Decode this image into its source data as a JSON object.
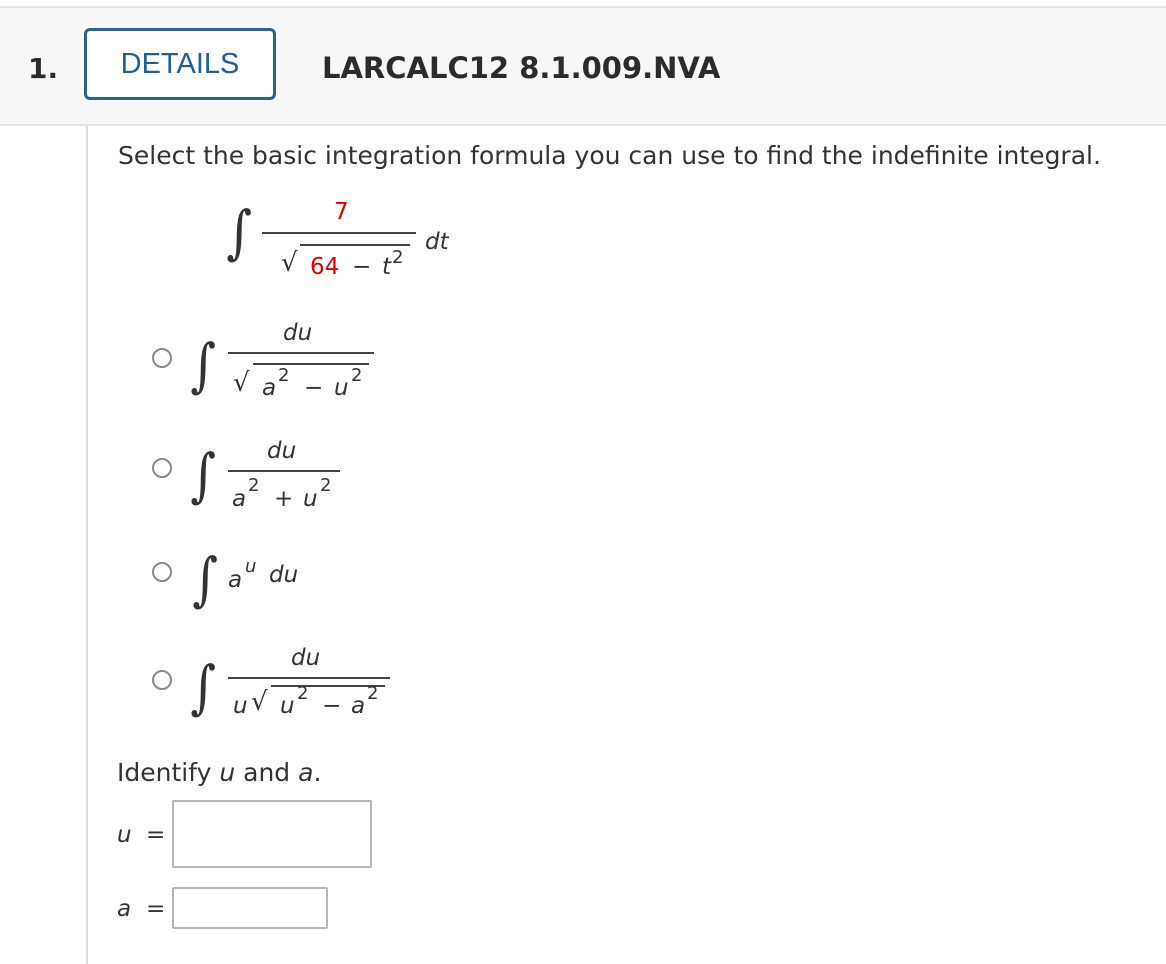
{
  "header": {
    "number": "1.",
    "details_label": "DETAILS",
    "question_id": "LARCALC12 8.1.009.NVA"
  },
  "prompt": "Select the basic integration formula you can use to find the indefinite integral.",
  "integral": {
    "numerator": "7",
    "radicand_const": "64",
    "minus": "−",
    "radicand_var": "t",
    "exp": "2",
    "differential": "dt"
  },
  "options": [
    {
      "numerator": "du",
      "denominator": "√(a² − u²)"
    },
    {
      "numerator": "du",
      "denominator": "a² + u²"
    },
    {
      "expression": "a^u du"
    },
    {
      "numerator": "du",
      "denominator": "u√(u² − a²)"
    }
  ],
  "identify": {
    "text_pre": "Identify ",
    "u_var": "u",
    "and": " and ",
    "a_var": "a",
    "period": ".",
    "u_label": "u",
    "a_label": "a",
    "equals": "=",
    "u_value": "",
    "a_value": ""
  },
  "symbols": {
    "integral": "∫",
    "radical": "√",
    "plus": "+",
    "minus": "−",
    "du": "du",
    "a": "a",
    "u": "u",
    "two": "2"
  },
  "colors": {
    "accent": "#1f5f96",
    "highlight": "#e00000"
  }
}
